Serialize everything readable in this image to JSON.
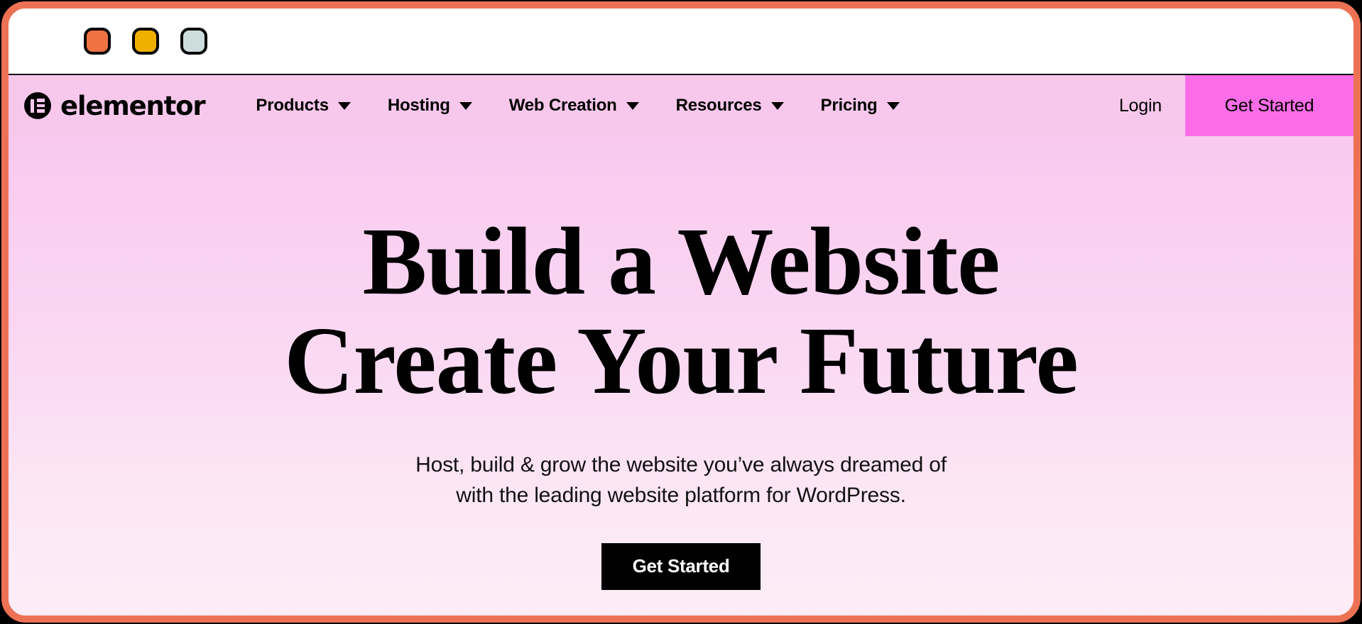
{
  "window": {
    "border_color": "#ED7254",
    "traffic_lights": [
      {
        "name": "close",
        "color": "#F07243"
      },
      {
        "name": "minimize",
        "color": "#F0B000"
      },
      {
        "name": "zoom",
        "color": "#CDDDDC"
      }
    ]
  },
  "header": {
    "brand": {
      "name": "elementor",
      "logo_icon": "elementor-logo-icon"
    },
    "nav": [
      {
        "label": "Products",
        "caret_icon": "chevron-down-icon"
      },
      {
        "label": "Hosting",
        "caret_icon": "chevron-down-icon"
      },
      {
        "label": "Web Creation",
        "caret_icon": "chevron-down-icon"
      },
      {
        "label": "Resources",
        "caret_icon": "chevron-down-icon"
      },
      {
        "label": "Pricing",
        "caret_icon": "chevron-down-icon"
      }
    ],
    "login_label": "Login",
    "cta_label": "Get Started",
    "cta_color": "#FB6DE8",
    "background_color": "#F8C8EC"
  },
  "hero": {
    "title_line1": "Build a Website",
    "title_line2": "Create Your Future",
    "subtitle_line1": "Host, build & grow the website you’ve always dreamed of",
    "subtitle_line2": "with the leading website platform for WordPress.",
    "cta_label": "Get Started",
    "cta_bg_color": "#000000",
    "cta_text_color": "#FFFFFF",
    "gradient_top": "#F9C8EF",
    "gradient_bottom": "#FDEDF7"
  }
}
